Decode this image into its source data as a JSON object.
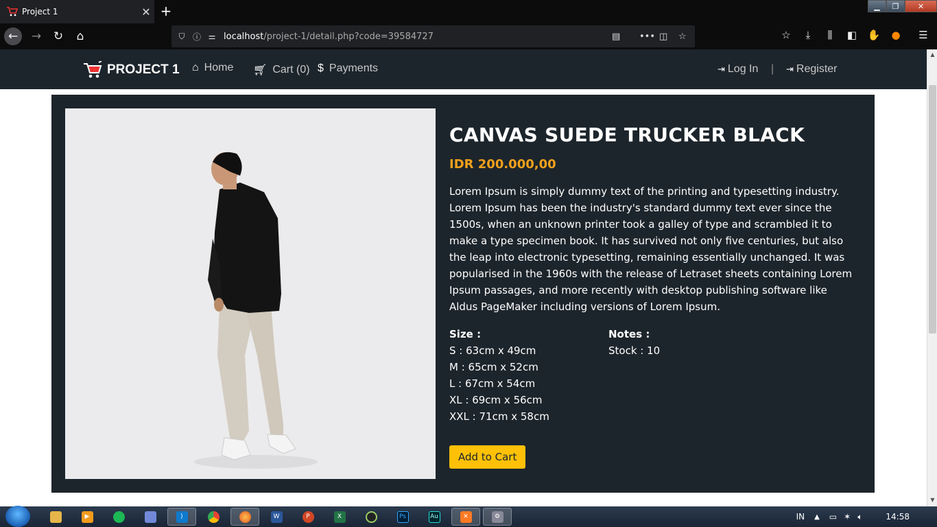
{
  "browser": {
    "tab_title": "Project 1",
    "url_host": "localhost",
    "url_path": "/project-1/detail.php?code=39584727"
  },
  "site": {
    "brand": "PROJECT 1",
    "nav": {
      "home": "Home",
      "cart": "Cart (0)",
      "payments": "Payments",
      "login": "Log In",
      "separator": "|",
      "register": "Register"
    }
  },
  "product": {
    "title": "CANVAS SUEDE TRUCKER BLACK",
    "price": "IDR 200.000,00",
    "description": "Lorem Ipsum is simply dummy text of the printing and typesetting industry. Lorem Ipsum has been the industry's standard dummy text ever since the 1500s, when an unknown printer took a galley of type and scrambled it to make a type specimen book. It has survived not only five centuries, but also the leap into electronic typesetting, remaining essentially unchanged. It was popularised in the 1960s with the release of Letraset sheets containing Lorem Ipsum passages, and more recently with desktop publishing software like Aldus PageMaker including versions of Lorem Ipsum.",
    "size_label": "Size :",
    "sizes": [
      "S : 63cm x 49cm",
      "M : 65cm x 52cm",
      "L : 67cm x 54cm",
      "XL : 69cm x 56cm",
      "XXL : 71cm x 58cm"
    ],
    "notes_label": "Notes :",
    "stock": "Stock : 10",
    "add_to_cart": "Add to Cart"
  },
  "taskbar": {
    "language": "IN",
    "clock": "14:58"
  },
  "colors": {
    "panel": "#1d252c",
    "price": "#f3a11b",
    "button": "#ffc107"
  }
}
